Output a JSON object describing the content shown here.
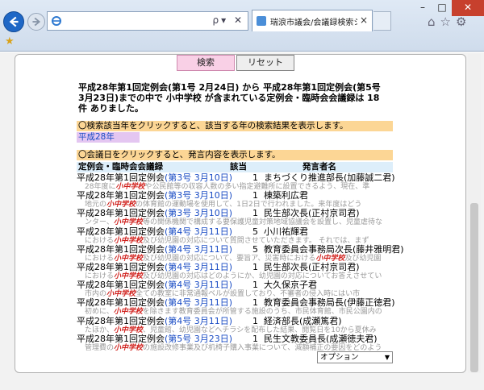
{
  "browser": {
    "tab_title": "瑞浪市議会/会議録検索シ...",
    "tab_close": "×",
    "window_controls": {
      "minimize": "–",
      "maximize": "□",
      "close": "✕"
    },
    "addr_tools": "ρ▾ ✕",
    "toolbar_icons": "⌂☆⚙"
  },
  "controls": {
    "search_label": "検索",
    "reset_label": "リセット"
  },
  "summary": "平成28年第1回定例会(第1号 2月24日) から 平成28年第1回定例会(第5号 3月23日)までの中で 小中学校 が含まれている定例会・臨時会会議録は 18件 ありました。",
  "year_instruction": "〇検索該当年をクリックすると、該当する年の検索結果を表示します。",
  "year_link": "平成28年",
  "meeting_instruction": "〇会議日をクリックすると、発言内容を表示します。",
  "table_headers": {
    "meeting": "定例会・臨時会会議録",
    "item": "該当",
    "speaker": "発言者名"
  },
  "results": [
    {
      "session": "平成28年第1回定例会",
      "date": "(第3号 3月10日)",
      "num": "1",
      "speaker": "まちづくり推進部長(加藤誠二君)",
      "snip_pre": "28年度に",
      "kw": "小中学校",
      "snip_post": "や公民館等の収容人数の多い指定避難所に設置できるよう、現在、準"
    },
    {
      "session": "平成28年第1回定例会",
      "date": "(第3号 3月10日)",
      "num": "1",
      "speaker": "棟築利広君",
      "snip_pre": "地元の",
      "kw": "小中学校",
      "snip_post": "の体育館の運動場を使用して、1日2日で行われました。来年度はどう"
    },
    {
      "session": "平成28年第1回定例会",
      "date": "(第3号 3月10日)",
      "num": "1",
      "speaker": "民生部次長(正村京司君)",
      "snip_pre": "ンター、",
      "kw": "小中学校",
      "snip_post": "等の関係機関で構成する要保護児童対策地域協議会を設置し、児童虐待な"
    },
    {
      "session": "平成28年第1回定例会",
      "date": "(第4号 3月11日)",
      "num": "5",
      "speaker": "小川祐輝君",
      "snip_pre": "における",
      "kw": "小中学校",
      "snip_post": "及び幼児園の対応について質問させていただきます。 それでは、まず"
    },
    {
      "session": "平成28年第1回定例会",
      "date": "(第4号 3月11日)",
      "num": "5",
      "speaker": "教育委員会事務局次長(藤井雅明君)",
      "snip_pre": "における",
      "kw": "小中学校",
      "snip_post": "及び幼児園の対応について、要旨ア、災害時における",
      "kw2": "小中学校",
      "snip_post2": "及び幼児園"
    },
    {
      "session": "平成28年第1回定例会",
      "date": "(第4号 3月11日)",
      "num": "1",
      "speaker": "民生部次長(正村京司君)",
      "snip_pre": "における",
      "kw": "小中学校",
      "snip_post": "及び幼児園の対応はどのようにか、幼児園の対応についてお答えさせてい"
    },
    {
      "session": "平成28年第1回定例会",
      "date": "(第4号 3月11日)",
      "num": "1",
      "speaker": "大久保京子君",
      "snip_pre": "市内の",
      "kw": "小中学校",
      "snip_post": "全ての教室に非常通報ベルが設置しており、不審者の侵入時にはい市"
    },
    {
      "session": "平成28年第1回定例会",
      "date": "(第4号 3月11日)",
      "num": "1",
      "speaker": "教育委員会事務局長(伊藤正徳君)",
      "snip_pre": "初めに、",
      "kw": "小中学校",
      "snip_post": "を除きます教育委員会が所管する施設のうち、市民体育館、市民公園内の"
    },
    {
      "session": "平成28年第1回定例会",
      "date": "(第4号 3月11日)",
      "num": "1",
      "speaker": "経済部長(成瀬篤君)",
      "snip_pre": "たほか、",
      "kw": "小中学校",
      "snip_post": "、児童館、幼児園などへチラシを配布した結果、閲覧日を10から夏休み"
    },
    {
      "session": "平成28年第1回定例会",
      "date": "(第5号 3月23日)",
      "num": "1",
      "speaker": "民生文教委員長(成瀬徳夫君)",
      "snip_pre": "管理費の",
      "kw": "小中学校",
      "snip_post": "の施設改修事業及び机椅子購入事業について、減額補正の要因をどのよう"
    }
  ],
  "select": {
    "value": "オプション"
  }
}
